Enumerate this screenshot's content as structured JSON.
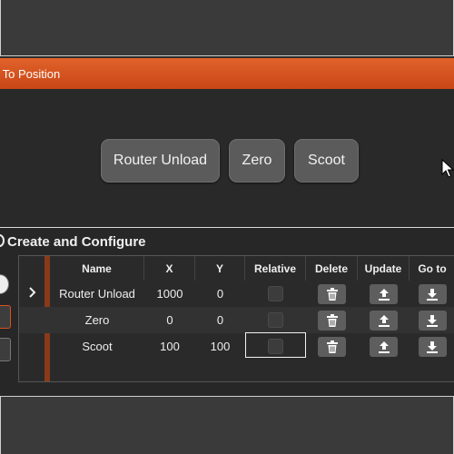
{
  "goto_panel": {
    "title": "g To Position",
    "buttons": [
      "Router Unload",
      "Zero",
      "Scoot"
    ]
  },
  "config_panel": {
    "title": "Create and Configure",
    "columns": [
      "Name",
      "X",
      "Y",
      "Relative",
      "Delete",
      "Update",
      "Go to"
    ],
    "rows": [
      {
        "name": "Router Unload",
        "x": "1000",
        "y": "0",
        "relative": false
      },
      {
        "name": "Zero",
        "x": "0",
        "y": "0",
        "relative": false
      },
      {
        "name": "Scoot",
        "x": "100",
        "y": "100",
        "relative": false
      }
    ]
  },
  "icons": {
    "delete": "trash-icon",
    "update": "upload-icon",
    "goto": "download-icon",
    "row_pointer": "chevron-right-icon"
  },
  "colors": {
    "header_accent": "#d9531e",
    "button_bg": "#5b5b5b"
  }
}
